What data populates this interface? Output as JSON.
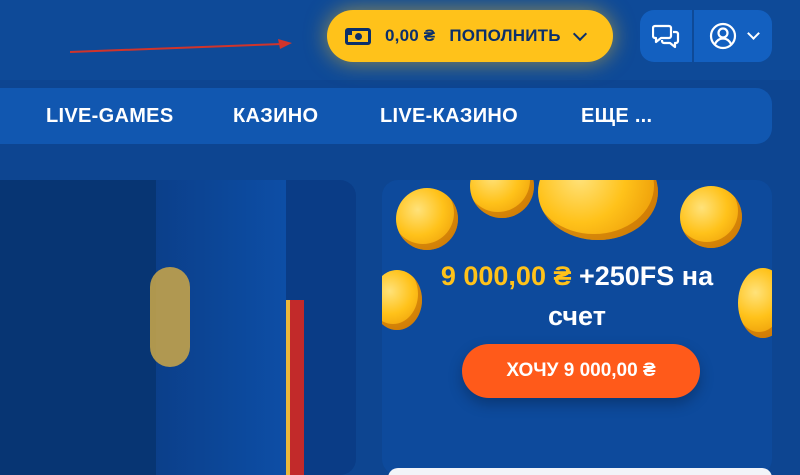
{
  "header": {
    "balance": "0,00 ₴",
    "deposit_label": "ПОПОЛНИТЬ",
    "icons": [
      "money-icon",
      "chevron-down-icon",
      "chat-icon",
      "user-icon",
      "chevron-down-icon"
    ]
  },
  "nav": {
    "items": [
      {
        "label": "LIVE-GAMES"
      },
      {
        "label": "КАЗИНО"
      },
      {
        "label": "LIVE-КАЗИНО"
      },
      {
        "label": "ЕЩЕ ..."
      }
    ]
  },
  "promo": {
    "amount": "9 000,00 ₴",
    "line1_suffix": " +250FS на",
    "line2": "счет",
    "cta_label": "ХОЧУ 9 000,00 ₴"
  },
  "colors": {
    "background": "#0d4591",
    "accent_yellow": "#ffc21a",
    "cta_orange": "#ff5a1a",
    "annotation_red": "#d0342b"
  }
}
